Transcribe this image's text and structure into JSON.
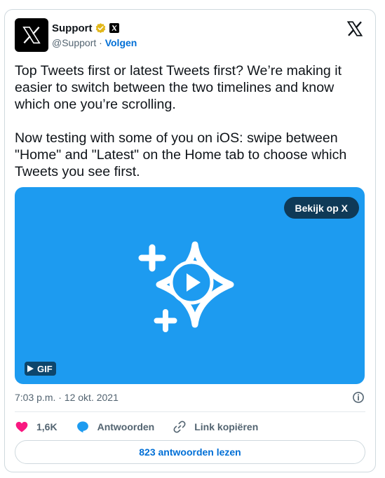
{
  "author": {
    "display_name": "Support",
    "handle": "@Support",
    "separator": "·",
    "follow_label": "Volgen"
  },
  "tweet": {
    "text": "Top Tweets first or latest Tweets first? We’re making it easier to switch between the two timelines and know which one you’re scrolling.\n\nNow testing with some of you on iOS: swipe between \"Home\" and \"Latest\" on the Home tab to choose which Tweets you see first.",
    "timestamp": "7:03 p.m. · 12 okt. 2021"
  },
  "media": {
    "watch_label": "Bekijk op X",
    "gif_label": "GIF",
    "background_color": "#1d9bf0"
  },
  "actions": {
    "like_count": "1,6K",
    "reply_label": "Antwoorden",
    "copy_link_label": "Link kopiëren"
  },
  "footer": {
    "read_replies_label": "823 antwoorden lezen"
  },
  "colors": {
    "link": "#006fd6",
    "like": "#f91880",
    "reply": "#1d9bf0",
    "verified": "#e2b719"
  },
  "icons": {
    "avatar": "x-logo-avatar",
    "verified": "verified-badge-icon",
    "affiliate": "x-affiliate-icon",
    "brand": "x-logo-icon",
    "info": "info-icon",
    "like": "heart-icon",
    "reply": "chat-bubble-icon",
    "copy_link": "link-icon",
    "play": "play-icon"
  }
}
